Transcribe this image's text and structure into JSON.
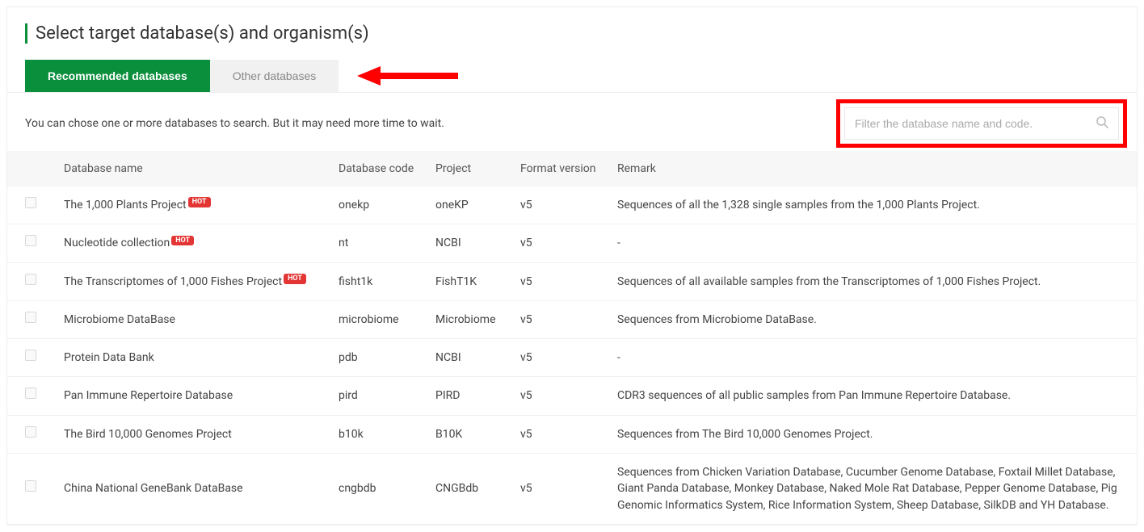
{
  "title": "Select target database(s) and organism(s)",
  "tabs": {
    "recommended": "Recommended databases",
    "other": "Other databases"
  },
  "subtext": "You can chose one or more databases to search. But it may need more time to wait.",
  "filter": {
    "placeholder": "Filter the database name and code."
  },
  "hot_label": "HOT",
  "columns": {
    "name": "Database name",
    "code": "Database code",
    "project": "Project",
    "format": "Format version",
    "remark": "Remark"
  },
  "rows": [
    {
      "name": "The 1,000 Plants Project",
      "hot": true,
      "code": "onekp",
      "project": "oneKP",
      "format": "v5",
      "remark": "Sequences of all the 1,328 single samples from the 1,000 Plants Project."
    },
    {
      "name": "Nucleotide collection",
      "hot": true,
      "code": "nt",
      "project": "NCBI",
      "format": "v5",
      "remark": "-"
    },
    {
      "name": "The Transcriptomes of 1,000 Fishes Project",
      "hot": true,
      "code": "fisht1k",
      "project": "FishT1K",
      "format": "v5",
      "remark": "Sequences of all available samples from the Transcriptomes of 1,000 Fishes Project."
    },
    {
      "name": "Microbiome DataBase",
      "hot": false,
      "code": "microbiome",
      "project": "Microbiome",
      "format": "v5",
      "remark": "Sequences from Microbiome DataBase."
    },
    {
      "name": "Protein Data Bank",
      "hot": false,
      "code": "pdb",
      "project": "NCBI",
      "format": "v5",
      "remark": "-"
    },
    {
      "name": "Pan Immune Repertoire Database",
      "hot": false,
      "code": "pird",
      "project": "PIRD",
      "format": "v5",
      "remark": "CDR3 sequences of all public samples from Pan Immune Repertoire Database."
    },
    {
      "name": "The Bird 10,000 Genomes Project",
      "hot": false,
      "code": "b10k",
      "project": "B10K",
      "format": "v5",
      "remark": "Sequences from The Bird 10,000 Genomes Project."
    },
    {
      "name": "China National GeneBank DataBase",
      "hot": false,
      "code": "cngbdb",
      "project": "CNGBdb",
      "format": "v5",
      "remark": "Sequences from Chicken Variation Database, Cucumber Genome Database, Foxtail Millet Database, Giant Panda Database, Monkey Database, Naked Mole Rat Database, Pepper Genome Database, Pig Genomic Informatics System, Rice Information System, Sheep Database, SilkDB and YH Database."
    }
  ]
}
